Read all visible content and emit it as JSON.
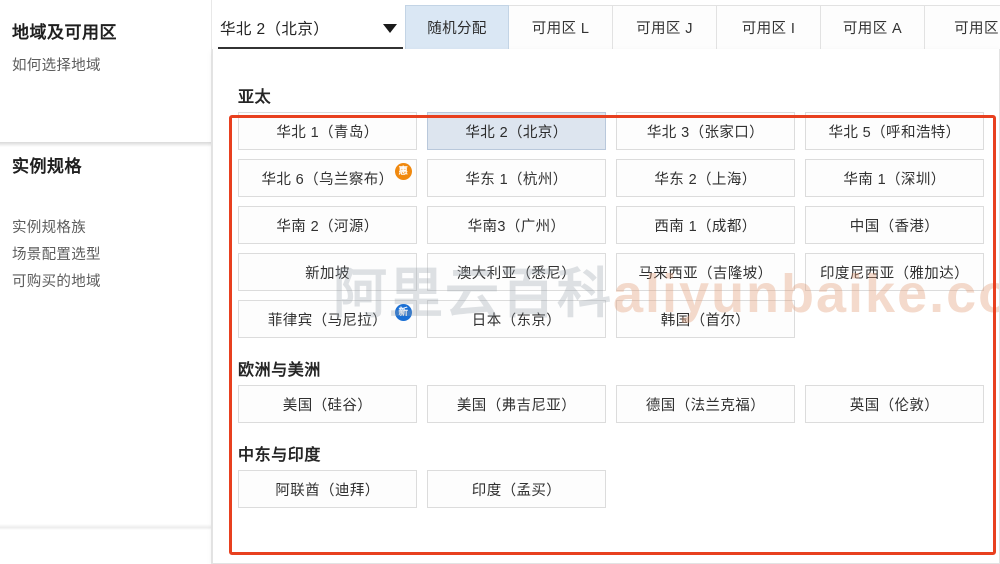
{
  "sidebar": {
    "section_region": {
      "title": "地域及可用区",
      "link": "如何选择地域"
    },
    "section_spec": {
      "title": "实例规格",
      "links": [
        "实例规格族",
        "场景配置选型",
        "可购买的地域"
      ]
    }
  },
  "region_select": {
    "value": "华北 2（北京）",
    "caret_icon": "chevron-down-icon"
  },
  "zone_tabs": [
    {
      "label": "随机分配",
      "active": true
    },
    {
      "label": "可用区 L",
      "active": false
    },
    {
      "label": "可用区 J",
      "active": false
    },
    {
      "label": "可用区 I",
      "active": false
    },
    {
      "label": "可用区 A",
      "active": false
    },
    {
      "label": "可用区",
      "active": false
    }
  ],
  "watermark": {
    "cn": "阿里云百科",
    "en": "aliyunbaike.com"
  },
  "annotation": {
    "color": "#e8401f"
  },
  "groups": [
    {
      "title": "亚太",
      "rows": [
        [
          {
            "label": "华北 1（青岛）",
            "selected": false,
            "badge": null
          },
          {
            "label": "华北 2（北京）",
            "selected": true,
            "badge": null
          },
          {
            "label": "华北 3（张家口）",
            "selected": false,
            "badge": null
          },
          {
            "label": "华北 5（呼和浩特）",
            "selected": false,
            "badge": null
          }
        ],
        [
          {
            "label": "华北 6（乌兰察布）",
            "selected": false,
            "badge": {
              "text": "惠",
              "color": "orange"
            }
          },
          {
            "label": "华东 1（杭州）",
            "selected": false,
            "badge": null
          },
          {
            "label": "华东 2（上海）",
            "selected": false,
            "badge": null
          },
          {
            "label": "华南 1（深圳）",
            "selected": false,
            "badge": null
          }
        ],
        [
          {
            "label": "华南 2（河源）",
            "selected": false,
            "badge": null
          },
          {
            "label": "华南3（广州）",
            "selected": false,
            "badge": null
          },
          {
            "label": "西南 1（成都）",
            "selected": false,
            "badge": null
          },
          {
            "label": "中国（香港）",
            "selected": false,
            "badge": null
          }
        ],
        [
          {
            "label": "新加坡",
            "selected": false,
            "badge": null
          },
          {
            "label": "澳大利亚（悉尼）",
            "selected": false,
            "badge": null
          },
          {
            "label": "马来西亚（吉隆坡）",
            "selected": false,
            "badge": null
          },
          {
            "label": "印度尼西亚（雅加达）",
            "selected": false,
            "badge": null
          }
        ],
        [
          {
            "label": "菲律宾（马尼拉）",
            "selected": false,
            "badge": {
              "text": "新",
              "color": "blue"
            }
          },
          {
            "label": "日本（东京）",
            "selected": false,
            "badge": null
          },
          {
            "label": "韩国（首尔）",
            "selected": false,
            "badge": null
          }
        ]
      ]
    },
    {
      "title": "欧洲与美洲",
      "rows": [
        [
          {
            "label": "美国（硅谷）",
            "selected": false,
            "badge": null
          },
          {
            "label": "美国（弗吉尼亚）",
            "selected": false,
            "badge": null
          },
          {
            "label": "德国（法兰克福）",
            "selected": false,
            "badge": null
          },
          {
            "label": "英国（伦敦）",
            "selected": false,
            "badge": null
          }
        ]
      ]
    },
    {
      "title": "中东与印度",
      "rows": [
        [
          {
            "label": "阿联酋（迪拜）",
            "selected": false,
            "badge": null
          },
          {
            "label": "印度（孟买）",
            "selected": false,
            "badge": null
          }
        ]
      ]
    }
  ]
}
